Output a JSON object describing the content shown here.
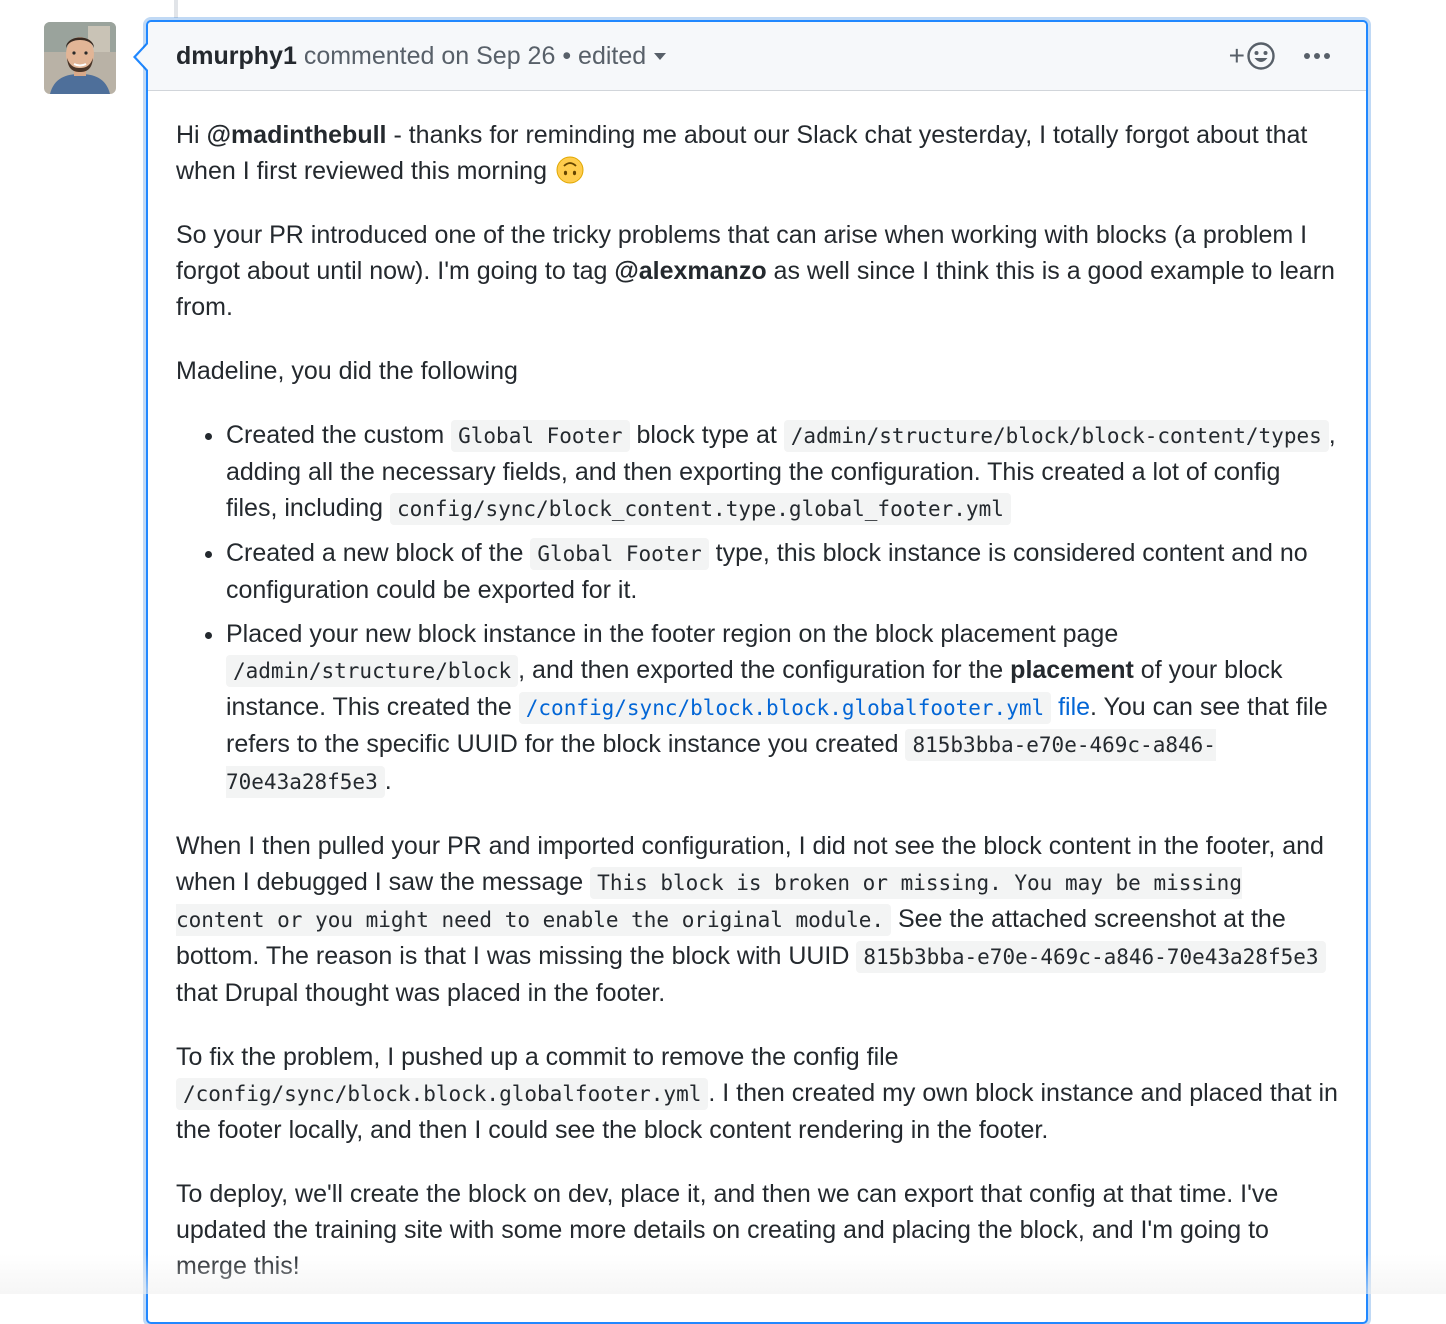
{
  "header": {
    "author": "dmurphy1",
    "commented_text": "commented on Sep 26",
    "separator": "•",
    "edited_label": "edited",
    "reaction_plus": "+",
    "reaction_icon": "smiley-icon",
    "more_icon": "kebab-horizontal-icon"
  },
  "body": {
    "p1": {
      "t1": "Hi ",
      "mention": "@madinthebull",
      "t2": " - thanks for reminding me about our Slack chat yesterday, I totally forgot about that when I first reviewed this morning ",
      "emoji": "upside-down-face-emoji"
    },
    "p2": {
      "t1": "So your PR introduced one of the tricky problems that can arise when working with blocks (a problem I forgot about until now). I'm going to tag ",
      "mention": "@alexmanzo",
      "t2": " as well since I think this is a good example to learn from."
    },
    "p3": "Madeline, you did the following",
    "list": {
      "item1": {
        "t1": "Created the custom ",
        "c1": "Global Footer",
        "t2": " block type at ",
        "c2": "/admin/structure/block/block-content/types",
        "t3": ", adding all the necessary fields, and then exporting the configuration. This created a lot of config files, including ",
        "c3": "config/sync/block_content.type.global_footer.yml"
      },
      "item2": {
        "t1": "Created a new block of the ",
        "c1": "Global Footer",
        "t2": " type, this block instance is considered content and no configuration could be exported for it."
      },
      "item3": {
        "t1": "Placed your new block instance in the footer region on the block placement page ",
        "c1": "/admin/structure/block",
        "t2": ", and then exported the configuration for the ",
        "bold": "placement",
        "t3": " of your block instance. This created the ",
        "link_code": "/config/sync/block.block.globalfooter.yml",
        "link_text": " file",
        "t4": ". You can see that file refers to the specific UUID for the block instance you created ",
        "c2": "815b3bba-e70e-469c-a846-70e43a28f5e3",
        "t5": "."
      }
    },
    "p4": {
      "t1": "When I then pulled your PR and imported configuration, I did not see the block content in the footer, and when I debugged I saw the message ",
      "c1": "This block is broken or missing. You may be missing content or you might need to enable the original module.",
      "t2": " See the attached screenshot at the bottom. The reason is that I was missing the block with UUID ",
      "c2": "815b3bba-e70e-469c-a846-70e43a28f5e3",
      "t3": " that Drupal thought was placed in the footer."
    },
    "p5": {
      "t1": "To fix the problem, I pushed up a commit to remove the config file ",
      "c1": "/config/sync/block.block.globalfooter.yml",
      "t2": ". I then created my own block instance and placed that in the footer locally, and then I could see the block content rendering in the footer."
    },
    "p6": "To deploy, we'll create the block on dev, place it, and then we can export that config at that time. I've updated the training site with some more details on creating and placing the block, and I'm going to merge this!"
  },
  "colors": {
    "focus_border": "#2188ff",
    "link": "#0366d6",
    "header_bg": "#f6f8fa",
    "code_bg": "#f3f4f4"
  }
}
